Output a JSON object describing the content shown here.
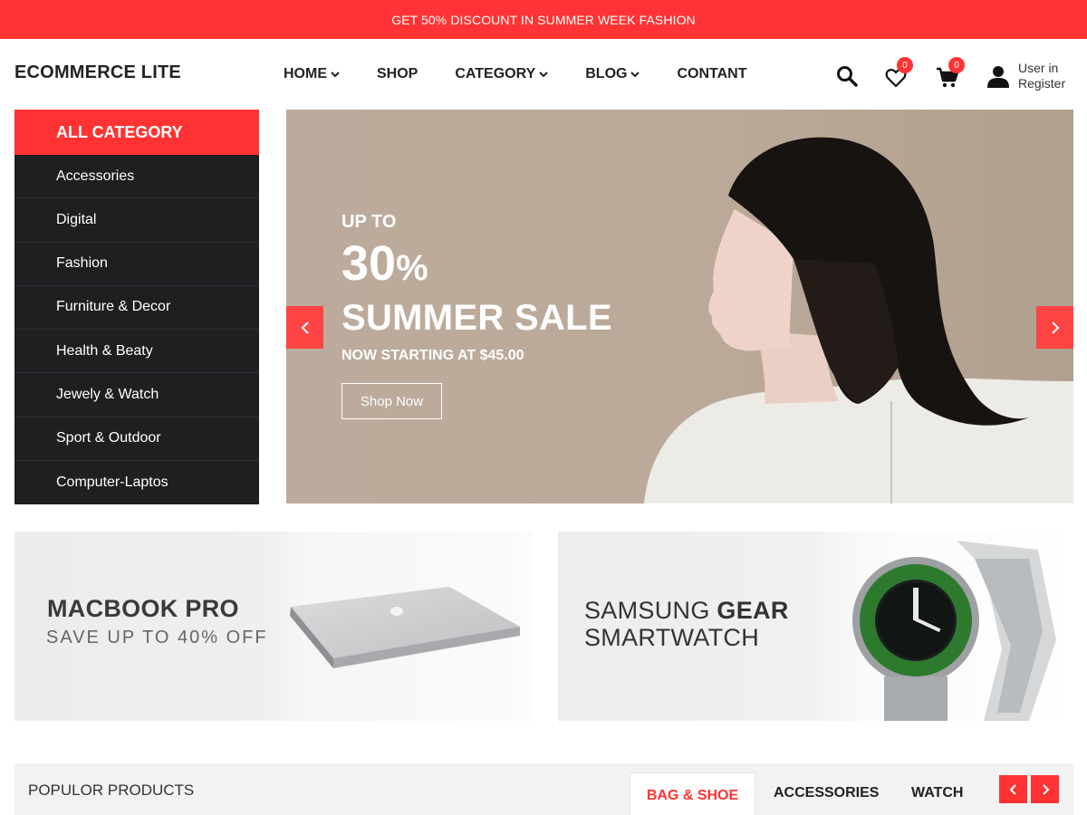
{
  "announcement": "GET 50% DISCOUNT IN SUMMER WEEK FASHION",
  "brand": "ECOMMERCE LITE",
  "nav": {
    "items": [
      {
        "label": "HOME",
        "dropdown": true
      },
      {
        "label": "SHOP",
        "dropdown": false
      },
      {
        "label": "CATEGORY",
        "dropdown": true
      },
      {
        "label": "BLOG",
        "dropdown": true
      },
      {
        "label": "CONTANT",
        "dropdown": false
      }
    ],
    "chevron": "⌄"
  },
  "header_icons": {
    "search": "search-icon",
    "wishlist": {
      "icon": "heart-icon",
      "count": "0"
    },
    "cart": {
      "icon": "cart-icon",
      "count": "0"
    },
    "user": {
      "icon": "user-icon",
      "login": "User in",
      "register": "Register"
    }
  },
  "sidebar": {
    "title": "ALL CATEGORY",
    "items": [
      {
        "label": "Accessories"
      },
      {
        "label": "Digital"
      },
      {
        "label": "Fashion"
      },
      {
        "label": "Furniture & Decor"
      },
      {
        "label": "Health & Beaty"
      },
      {
        "label": "Jewely & Watch"
      },
      {
        "label": "Sport & Outdoor"
      },
      {
        "label": "Computer-Laptos"
      }
    ]
  },
  "hero": {
    "kicker": "UP TO",
    "percent": "30",
    "percent_sign": "%",
    "headline": "SUMMER SALE",
    "subline": "NOW STARTING AT $45.00",
    "cta": "Shop Now",
    "prev": "‹",
    "next": "›"
  },
  "promos": [
    {
      "title": "MACBOOK PRO",
      "subtitle": "SAVE UP TO 40% OFF"
    },
    {
      "title_light": "SAMSUNG ",
      "title_bold": "GEAR",
      "line2": "SMARTWATCH"
    }
  ],
  "products": {
    "title": "POPULOR PRODUCTS",
    "tabs": [
      {
        "label": "BAG & SHOE",
        "active": true
      },
      {
        "label": "ACCESSORIES",
        "active": false
      },
      {
        "label": "WATCH",
        "active": false
      }
    ],
    "prev": "‹",
    "next": "›"
  },
  "colors": {
    "accent": "#ff3333",
    "sidebar_bg": "#1e1f21",
    "hero_bg": "#bcab9c"
  }
}
